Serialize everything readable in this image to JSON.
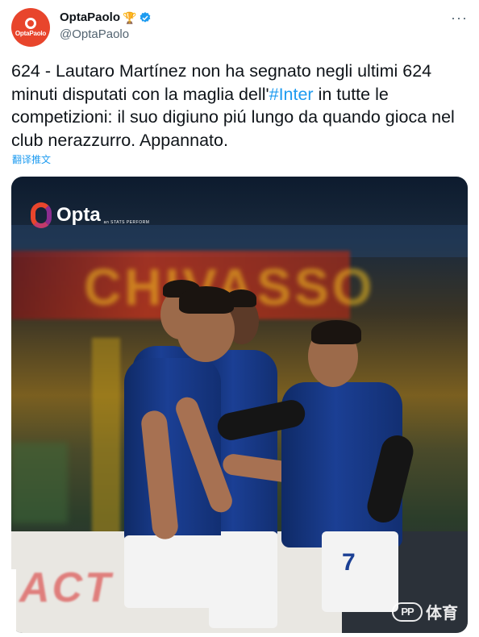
{
  "tweet": {
    "author": {
      "display_name": "OptaPaolo",
      "handle": "@OptaPaolo",
      "avatar_label": "OptaPaolo",
      "badges": [
        "trophy-icon",
        "verified-icon"
      ]
    },
    "text_before": "624 - Lautaro Martínez non ha segnato negli ultimi 624 minuti disputati con la maglia dell'",
    "hashtag": "#Inter",
    "text_after": " in tutte le competizioni: il suo digiuno piú lungo da quando gioca nel club nerazzurro. Appannato.",
    "translate_label": "翻译推文",
    "more_label": "···"
  },
  "media": {
    "opta_logo_word": "Opta",
    "opta_logo_sub": "an STATS PERFORM",
    "jersey_number": "7",
    "banner_text": "CHIVASSO",
    "ad_text": "ACT",
    "watermark_mark": "PP",
    "watermark_text": "体育"
  },
  "colors": {
    "link": "#1d9bf0",
    "verified": "#1d9bf0",
    "avatar_bg": "#e8452c",
    "inter_blue": "#1b3f94"
  }
}
